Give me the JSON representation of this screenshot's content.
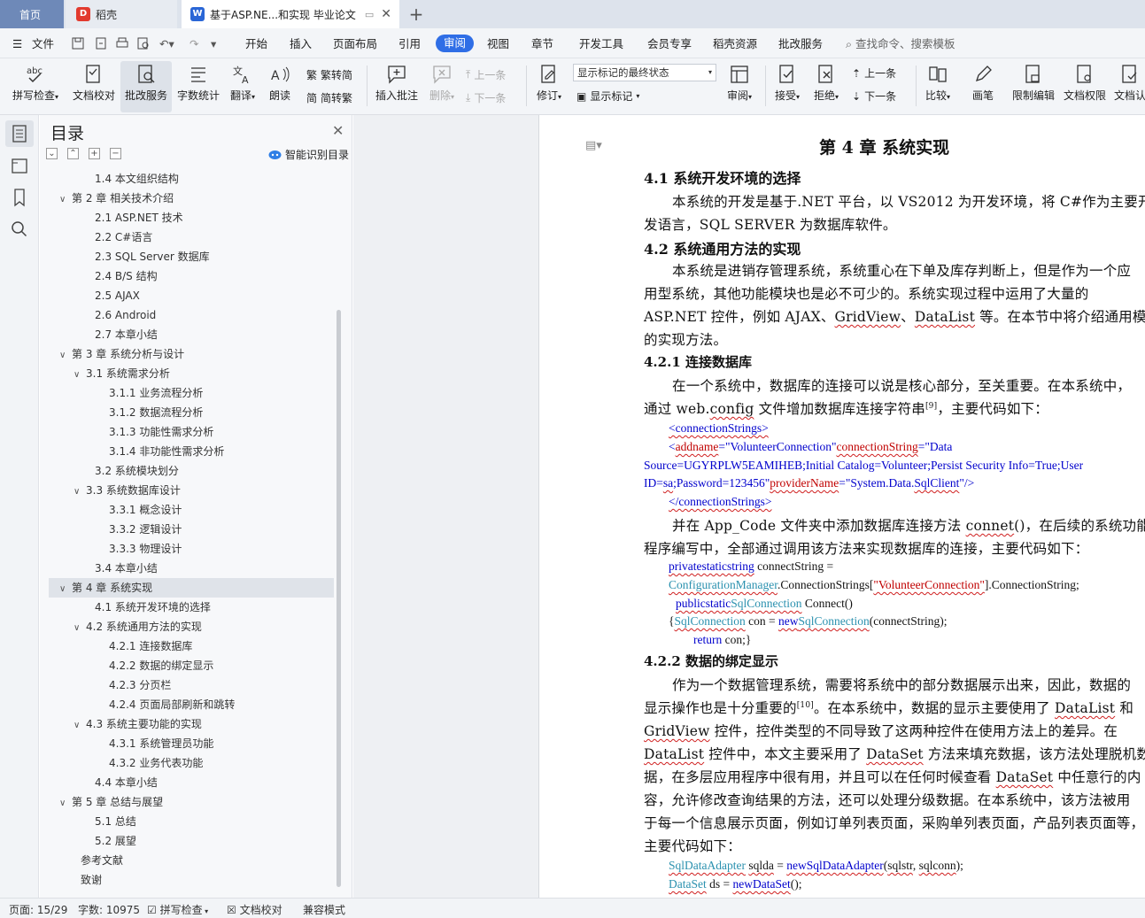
{
  "tabs": {
    "home": "首页",
    "daoke": "稻壳",
    "doc": "基于ASP.NE...和实现 毕业论文"
  },
  "menu": {
    "file": "文件",
    "items": [
      "开始",
      "插入",
      "页面布局",
      "引用",
      "审阅",
      "视图",
      "章节",
      "开发工具",
      "会员专享",
      "稻壳资源",
      "批改服务"
    ],
    "search": "查找命令、搜索模板"
  },
  "ribbon": {
    "spell": "拼写检查",
    "proof": "文档校对",
    "correct": "批改服务",
    "wordcount": "字数统计",
    "translate": "翻译",
    "read": "朗读",
    "trad": "繁转简",
    "simp": "简转繁",
    "insert_comment": "插入批注",
    "delete": "删除",
    "prev_comment": "上一条",
    "next_comment": "下一条",
    "revise": "修订",
    "markup_state": "显示标记的最终状态",
    "show_markup": "显示标记",
    "review": "审阅",
    "accept": "接受",
    "reject": "拒绝",
    "prev": "上一条",
    "next": "下一条",
    "compare": "比较",
    "pen": "画笔",
    "restrict": "限制编辑",
    "doc_perm": "文档权限",
    "doc_cert": "文档认"
  },
  "toc": {
    "title": "目录",
    "smart": "智能识别目录",
    "items": [
      {
        "text": "1.4  本文组织结构",
        "level": 2,
        "chev": ""
      },
      {
        "text": "第 2 章  相关技术介绍",
        "level": 1,
        "chev": "v"
      },
      {
        "text": "2.1 ASP.NET 技术",
        "level": 2,
        "chev": ""
      },
      {
        "text": "2.2 C#语言",
        "level": 2,
        "chev": ""
      },
      {
        "text": "2.3 SQL Server 数据库",
        "level": 2,
        "chev": ""
      },
      {
        "text": "2.4 B/S 结构",
        "level": 2,
        "chev": ""
      },
      {
        "text": "2.5 AJAX",
        "level": 2,
        "chev": ""
      },
      {
        "text": "2.6 Android",
        "level": 2,
        "chev": ""
      },
      {
        "text": "2.7 本章小结",
        "level": 2,
        "chev": ""
      },
      {
        "text": "第 3 章  系统分析与设计",
        "level": 1,
        "chev": "v"
      },
      {
        "text": "3.1  系统需求分析",
        "level": 2,
        "chev": "v"
      },
      {
        "text": "3.1.1  业务流程分析",
        "level": 3,
        "chev": ""
      },
      {
        "text": "3.1.2  数据流程分析",
        "level": 3,
        "chev": ""
      },
      {
        "text": "3.1.3  功能性需求分析",
        "level": 3,
        "chev": ""
      },
      {
        "text": "3.1.4  非功能性需求分析",
        "level": 3,
        "chev": ""
      },
      {
        "text": "3.2  系统模块划分",
        "level": 2,
        "chev": ""
      },
      {
        "text": "3.3  系统数据库设计",
        "level": 2,
        "chev": "v"
      },
      {
        "text": "3.3.1  概念设计",
        "level": 3,
        "chev": ""
      },
      {
        "text": "3.3.2  逻辑设计",
        "level": 3,
        "chev": ""
      },
      {
        "text": "3.3.3  物理设计",
        "level": 3,
        "chev": ""
      },
      {
        "text": "3.4  本章小结",
        "level": 2,
        "chev": ""
      },
      {
        "text": "第 4 章  系统实现",
        "level": 1,
        "chev": "v",
        "selected": true
      },
      {
        "text": "4.1  系统开发环境的选择",
        "level": 2,
        "chev": ""
      },
      {
        "text": "4.2  系统通用方法的实现",
        "level": 2,
        "chev": "v"
      },
      {
        "text": "4.2.1  连接数据库",
        "level": 3,
        "chev": ""
      },
      {
        "text": "4.2.2  数据的绑定显示",
        "level": 3,
        "chev": ""
      },
      {
        "text": "4.2.3  分页栏",
        "level": 3,
        "chev": ""
      },
      {
        "text": "4.2.4  页面局部刷新和跳转",
        "level": 3,
        "chev": ""
      },
      {
        "text": "4.3  系统主要功能的实现",
        "level": 2,
        "chev": "v"
      },
      {
        "text": "4.3.1  系统管理员功能",
        "level": 3,
        "chev": ""
      },
      {
        "text": "4.3.2  业务代表功能",
        "level": 3,
        "chev": ""
      },
      {
        "text": "4.4  本章小结",
        "level": 2,
        "chev": ""
      },
      {
        "text": "第 5 章  总结与展望",
        "level": 1,
        "chev": "v"
      },
      {
        "text": "5.1  总结",
        "level": 2,
        "chev": ""
      },
      {
        "text": "5.2  展望",
        "level": 2,
        "chev": ""
      },
      {
        "text": "参考文献",
        "level": 1,
        "chev": ""
      },
      {
        "text": "致谢",
        "level": 1,
        "chev": ""
      }
    ]
  },
  "doc": {
    "chapter": "第 4 章  系统实现",
    "h41": "4.1  系统开发环境的选择",
    "p41a": "本系统的开发是基于.NET 平台，以 VS2012 为开发环境，将 C#作为主要开",
    "p41b": "发语言，SQL SERVER 为数据库软件。",
    "h42": "4.2  系统通用方法的实现",
    "p42a": "本系统是进销存管理系统，系统重心在下单及库存判断上，但是作为一个应",
    "p42b": "用型系统，其他功能模块也是必不可少的。系统实现过程中运用了大量的",
    "p42c1": "ASP.NET 控件，例如 AJAX、",
    "p42c_gv": "GridView",
    "p42c2": "、",
    "p42c_dl": "DataList",
    "p42c3": " 等。在本节中将介绍通用模块",
    "p42d": "的实现方法。",
    "h421": "4.2.1  连接数据库",
    "p421a": "在一个系统中，数据库的连接可以说是核心部分，至关重要。在本系统中，",
    "p421b1": "通过 web.",
    "p421b_cfg": "config",
    "p421b2": " 文件增加数据库连接字符串",
    "p421b_ref": "[9]",
    "p421b3": "，主要代码如下：",
    "c1": "<connectionStrings>",
    "c2a": "<",
    "c2b": "addname",
    "c2c": "=\"VolunteerConnection\"",
    "c2d": "connectionString",
    "c2e": "=\"Data",
    "c3": "Source=UGYRPLW5EAMIHEB;Initial Catalog=Volunteer;Persist Security Info=True;User",
    "c4a": "ID=",
    "c4b": "sa",
    "c4c": ";Password=123456\"",
    "c4d": "providerName",
    "c4e": "=\"System.Data.",
    "c4f": "SqlClient",
    "c4g": "\"/>",
    "c5": "</connectionStrings>",
    "p421c1": "并在 App_Code 文件夹中添加数据库连接方法 ",
    "p421c_cn": "connet",
    "p421c2": "()，在后续的系统功能",
    "p421d": "程序编写中，全部通过调用该方法来实现数据库的连接，主要代码如下：",
    "d1a": "privatestaticstring",
    "d1b": " connectString =",
    "d2a": "ConfigurationManager",
    "d2b": ".ConnectionStrings[",
    "d2c": "\"VolunteerConnection\"",
    "d2d": "].ConnectionString;",
    "d3a": "publicstatic",
    "d3b": "SqlConnection",
    "d3c": " Connect()",
    "d4a": "{",
    "d4b": "SqlConnection",
    "d4c": " con = ",
    "d4d": "new",
    "d4e": "SqlConnection",
    "d4f": "(connectString);",
    "d5a": "return",
    "d5b": " con;}",
    "h422": "4.2.2  数据的绑定显示",
    "p422a": "作为一个数据管理系统，需要将系统中的部分数据展示出来，因此，数据的",
    "p422b1": "显示操作也是十分重要的",
    "p422b_ref": "[10]",
    "p422b2": "。在本系统中，数据的显示主要使用了 ",
    "p422b_dl": "DataList",
    "p422b3": " 和",
    "p422c_gv": "GridView",
    "p422c2": " 控件，控件类型的不同导致了这两种控件在使用方法上的差异。在",
    "p422d_dl": "DataList",
    "p422d2": " 控件中，本文主要采用了 ",
    "p422d_ds": "DataSet",
    "p422d3": " 方法来填充数据，该方法处理脱机数",
    "p422e1": "据，在多层应用程序中很有用，并且可以在任何时候查看 ",
    "p422e_ds": "DataSet",
    "p422e2": " 中任意行的内",
    "p422f": "容，允许修改查询结果的方法，还可以处理分级数据。在本系统中，该方法被用",
    "p422g": "于每一个信息展示页面，例如订单列表页面，采购单列表页面，产品列表页面等，",
    "p422h": "主要代码如下：",
    "e1a": "SqlDataAdapter",
    "e1b": " ",
    "e1c": "sqlda",
    "e1d": " = ",
    "e1e": "newSqlDataAdapter",
    "e1f": "(",
    "e1g": "sqlstr",
    "e1h": ", ",
    "e1i": "sqlconn",
    "e1j": ");",
    "e2a": "DataSet",
    "e2b": " ds = ",
    "e2c": "newDataSet",
    "e2d": "();"
  },
  "status": {
    "page": "页面: 15/29",
    "words": "字数: 10975",
    "spell": "拼写检查",
    "proof": "文档校对",
    "compat": "兼容模式"
  }
}
